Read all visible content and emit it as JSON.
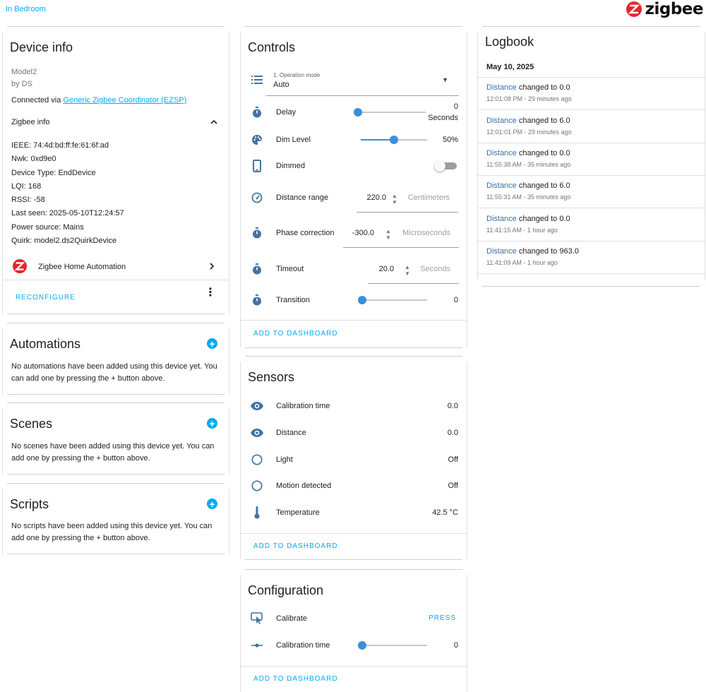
{
  "area_link": "In Bedroom",
  "brand": {
    "text": "zigbee",
    "logo_icon": "zigbee-logo",
    "color": "#e4262c"
  },
  "device_info": {
    "title": "Device info",
    "model": "Model2",
    "manufacturer": "by DS",
    "connected_prefix": "Connected via ",
    "connected_link": "Generic Zigbee Coordinator (EZSP)",
    "zigbee_info_label": "Zigbee info",
    "details": [
      "IEEE: 74:4d:bd:ff:fe:61:6f:ad",
      "Nwk: 0xd9e0",
      "Device Type: EndDevice",
      "LQI: 168",
      "RSSI: -58",
      "Last seen: 2025-05-10T12:24:57",
      "Power source: Mains",
      "Quirk: model2.ds2QuirkDevice"
    ],
    "integration": "Zigbee Home Automation",
    "reconfigure": "RECONFIGURE"
  },
  "automations": {
    "title": "Automations",
    "text": "No automations have been added using this device yet. You can add one by pressing the + button above."
  },
  "scenes": {
    "title": "Scenes",
    "text": "No scenes have been added using this device yet. You can add one by pressing the + button above."
  },
  "scripts": {
    "title": "Scripts",
    "text": "No scripts have been added using this device yet. You can add one by pressing the + button above."
  },
  "controls": {
    "title": "Controls",
    "operation_mode": {
      "label": "1. Operation mode",
      "value": "Auto"
    },
    "delay": {
      "label": "Delay",
      "value": "0",
      "unit": "Seconds",
      "level": 0
    },
    "dim_level": {
      "label": "Dim Level",
      "value": "50%",
      "level": 0.5
    },
    "dimmed": {
      "label": "Dimmed",
      "state": "off"
    },
    "distance_range": {
      "label": "Distance range",
      "value": "220.0",
      "unit": "Centimeters"
    },
    "phase_correction": {
      "label": "Phase correction",
      "value": "-300.0",
      "unit": "Microseconds"
    },
    "timeout": {
      "label": "Timeout",
      "value": "20.0",
      "unit": "Seconds"
    },
    "transition": {
      "label": "Transition",
      "value": "0",
      "level": 0
    },
    "add_to_dashboard": "ADD TO DASHBOARD"
  },
  "sensors": {
    "title": "Sensors",
    "rows": [
      {
        "label": "Calibration time",
        "value": "0.0",
        "icon": "eye-icon"
      },
      {
        "label": "Distance",
        "value": "0.0",
        "icon": "eye-icon"
      },
      {
        "label": "Light",
        "value": "Off",
        "icon": "circle-outline-icon"
      },
      {
        "label": "Motion detected",
        "value": "Off",
        "icon": "circle-outline-icon"
      },
      {
        "label": "Temperature",
        "value": "42.5 °C",
        "icon": "thermometer-icon"
      }
    ],
    "add_to_dashboard": "ADD TO DASHBOARD"
  },
  "configuration": {
    "title": "Configuration",
    "calibrate": {
      "label": "Calibrate",
      "action": "PRESS"
    },
    "calibration_time": {
      "label": "Calibration time",
      "value": "0",
      "level": 0
    },
    "add_to_dashboard": "ADD TO DASHBOARD"
  },
  "logbook": {
    "title": "Logbook",
    "date": "May 10, 2025",
    "entries": [
      {
        "entity": "Distance",
        "text": " changed to 0.0",
        "time": "12:01:08 PM - 29 minutes ago"
      },
      {
        "entity": "Distance",
        "text": " changed to 6.0",
        "time": "12:01:01 PM - 29 minutes ago"
      },
      {
        "entity": "Distance",
        "text": " changed to 0.0",
        "time": "11:55:38 AM - 35 minutes ago"
      },
      {
        "entity": "Distance",
        "text": " changed to 6.0",
        "time": "11:55:31 AM - 35 minutes ago"
      },
      {
        "entity": "Distance",
        "text": " changed to 0.0",
        "time": "11:41:15 AM - 1 hour ago"
      },
      {
        "entity": "Distance",
        "text": " changed to 963.0",
        "time": "11:41:09 AM - 1 hour ago"
      }
    ]
  }
}
